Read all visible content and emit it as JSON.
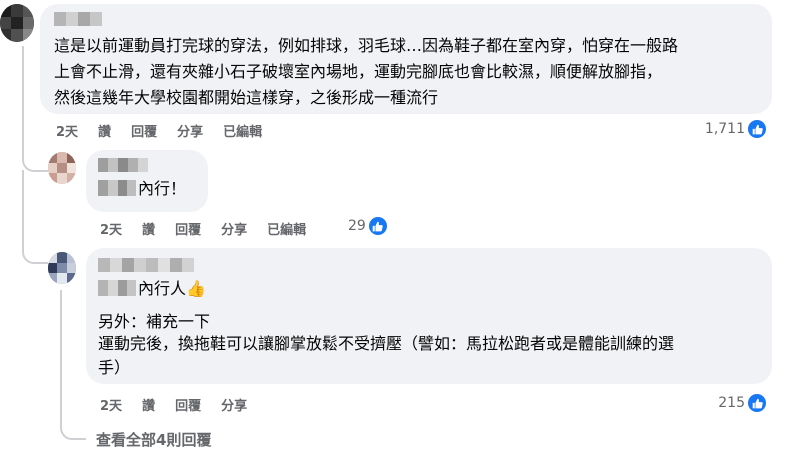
{
  "comments": [
    {
      "author": "",
      "text_lines": [
        "這是以前運動員打完球的穿法，例如排球，羽毛球…因為鞋子都在室內穿，怕穿在一般路",
        "上會不止滑，還有夾雜小石子破壞室內場地，運動完腳底也會比較濕，順便解放腳指，",
        "然後這幾年大學校園都開始這樣穿，之後形成一種流行"
      ],
      "time": "2天",
      "like_label": "讚",
      "reply_label": "回覆",
      "share_label": "分享",
      "edited_label": "已編輯",
      "like_count": "1,711"
    },
    {
      "author": "",
      "text": "內行！",
      "time": "2天",
      "like_label": "讚",
      "reply_label": "回覆",
      "share_label": "分享",
      "edited_label": "已編輯",
      "like_count": "29"
    },
    {
      "author": "",
      "text_first": "內行人",
      "emoji": "👍",
      "text_lines": [
        "另外：補充一下",
        "運動完後，換拖鞋可以讓腳掌放鬆不受擠壓（譬如：馬拉松跑者或是體能訓練的選",
        "手）"
      ],
      "time": "2天",
      "like_label": "讚",
      "reply_label": "回覆",
      "share_label": "分享",
      "like_count": "215"
    }
  ],
  "view_more_label": "查看全部4則回覆",
  "colors": {
    "bubble": "#f0f2f5",
    "meta": "#65676b",
    "like_blue": "#1877f2",
    "thread_line": "#ced0d4"
  }
}
